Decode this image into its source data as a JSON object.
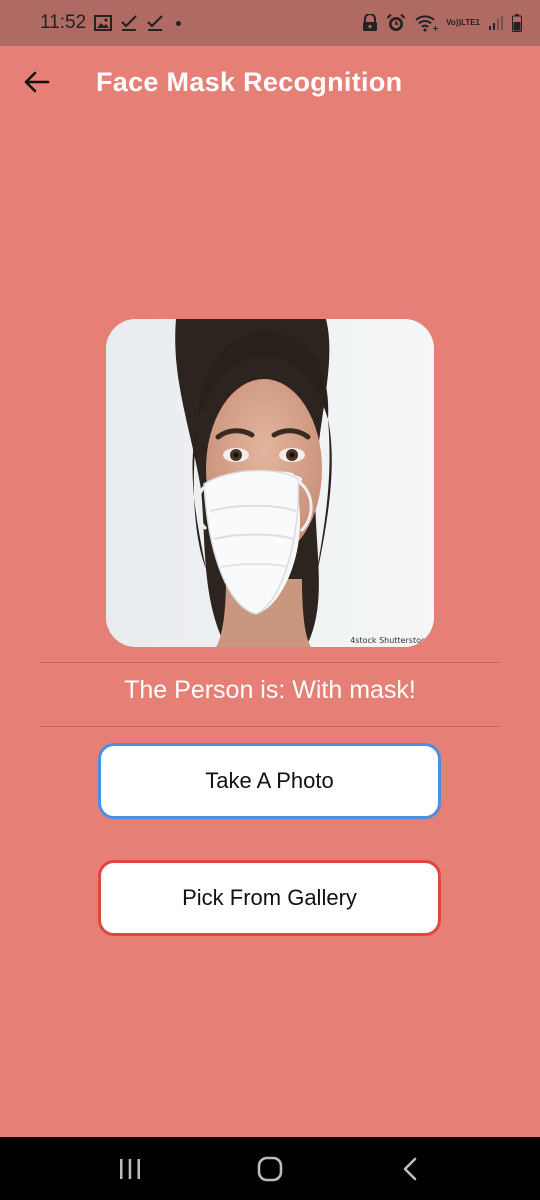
{
  "status_bar": {
    "time": "11:52",
    "left_icons": [
      "image-icon",
      "download-check-icon",
      "download-check-icon"
    ],
    "right_icons": [
      "alarm-lock-icon",
      "alarm-clock-icon",
      "wifi-calling-icon",
      "volte-icon",
      "signal-icon",
      "battery-icon"
    ],
    "volte_top": "Vo))",
    "volte_bottom": "LTE1"
  },
  "app_bar": {
    "back_icon": "arrow-left-icon",
    "title": "Face Mask Recognition"
  },
  "main": {
    "result_label": "The Person is: With mask!",
    "watermark": "4stock Shutterstock"
  },
  "buttons": {
    "take_photo": "Take A Photo",
    "pick_gallery": "Pick From Gallery"
  },
  "colors": {
    "background": "#E67F76",
    "status_bar": "#B06A64",
    "take_photo_border": "#4A90E2",
    "pick_gallery_border": "#E0463E"
  },
  "nav_bar": {
    "icons": [
      "recents-icon",
      "home-icon",
      "back-icon"
    ]
  }
}
